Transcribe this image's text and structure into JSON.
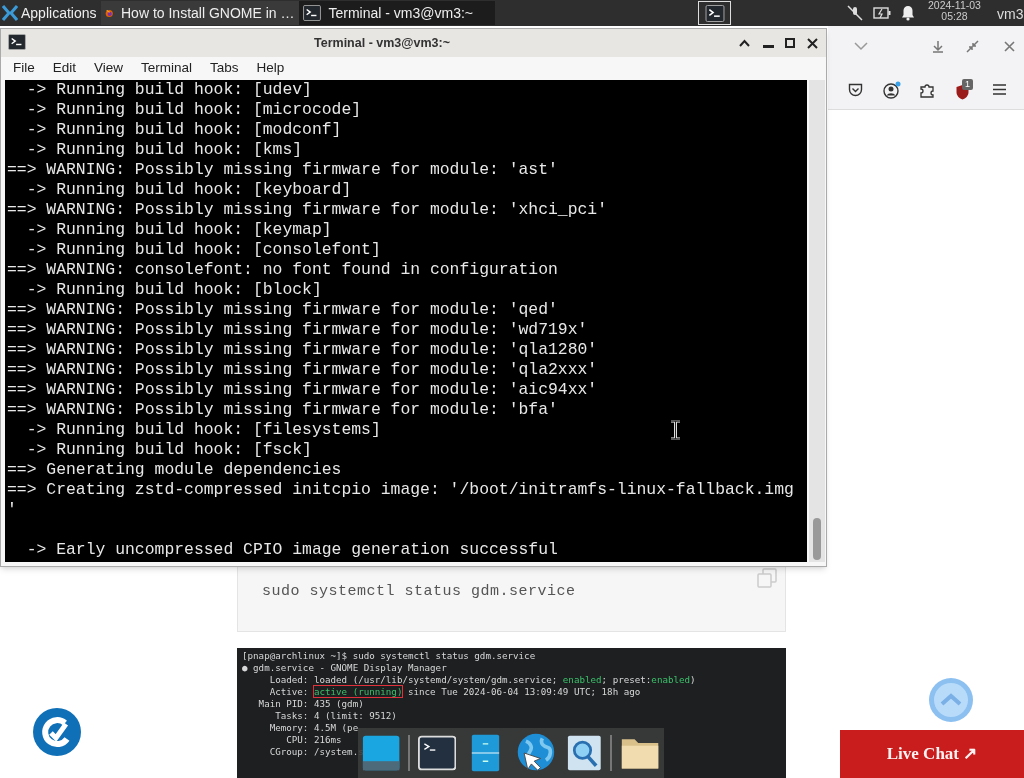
{
  "taskbar": {
    "menu_label": "Applications",
    "tasks": [
      {
        "label": "How to Install GNOME in …",
        "kind": "browser",
        "selected": false
      },
      {
        "label": "Terminal - vm3@vm3:~",
        "kind": "terminal",
        "selected": true
      }
    ],
    "date": "2024-11-03",
    "time": "05:28",
    "user": "vm3"
  },
  "terminal": {
    "title": "Terminal - vm3@vm3:~",
    "menu": [
      "File",
      "Edit",
      "View",
      "Terminal",
      "Tabs",
      "Help"
    ],
    "lines": [
      {
        "text": "  -> Running build hook: [udev]"
      },
      {
        "text": "  -> Running build hook: [microcode]"
      },
      {
        "text": "  -> Running build hook: [modconf]"
      },
      {
        "text": "  -> Running build hook: [kms]"
      },
      {
        "text": "==> WARNING: Possibly missing firmware for module: 'ast'"
      },
      {
        "text": "  -> Running build hook: [keyboard]"
      },
      {
        "text": "==> WARNING: Possibly missing firmware for module: 'xhci_pci'"
      },
      {
        "text": "  -> Running build hook: [keymap]"
      },
      {
        "text": "  -> Running build hook: [consolefont]"
      },
      {
        "text": "==> WARNING: consolefont: no font found in configuration"
      },
      {
        "text": "  -> Running build hook: [block]"
      },
      {
        "text": "==> WARNING: Possibly missing firmware for module: 'qed'"
      },
      {
        "text": "==> WARNING: Possibly missing firmware for module: 'wd719x'"
      },
      {
        "text": "==> WARNING: Possibly missing firmware for module: 'qla1280'"
      },
      {
        "text": "==> WARNING: Possibly missing firmware for module: 'qla2xxx'"
      },
      {
        "text": "==> WARNING: Possibly missing firmware for module: 'aic94xx'"
      },
      {
        "text": "==> WARNING: Possibly missing firmware for module: 'bfa'"
      },
      {
        "text": "  -> Running build hook: [filesystems]"
      },
      {
        "text": "  -> Running build hook: [fsck]"
      },
      {
        "text": "==> Generating module dependencies"
      },
      {
        "text": "==> Creating zstd-compressed initcpio image: '/boot/initramfs-linux-fallback.img"
      },
      {
        "text": "'"
      },
      {
        "text": "  -> Early uncompressed CPIO image generation successful",
        "blank_before": true
      }
    ]
  },
  "browser": {
    "badge": "1",
    "code_block": "sudo systemctl status gdm.service",
    "screenshot_lines": [
      {
        "text": "[pnap@archlinux ~]$ sudo systemctl status gdm.service"
      },
      {
        "text": "● gdm.service - GNOME Display Manager"
      },
      {
        "text": "     Loaded: loaded (/usr/lib/systemd/system/gdm.service; **enabled**; preset:**enabled**)"
      },
      {
        "text": "     Active: ",
        "highlight": "active (running)",
        "rest": " since Tue 2024-06-04 13:09:49 UTC; 18h ago"
      },
      {
        "text": "   Main PID: 435 (gdm)"
      },
      {
        "text": "      Tasks: 4 (limit: 9512)"
      },
      {
        "text": "     Memory: 4.5M (pe"
      },
      {
        "text": "        CPU: 216ms"
      },
      {
        "text": "     CGroup: /system.s"
      }
    ],
    "live_chat": "Live Chat ↗"
  }
}
